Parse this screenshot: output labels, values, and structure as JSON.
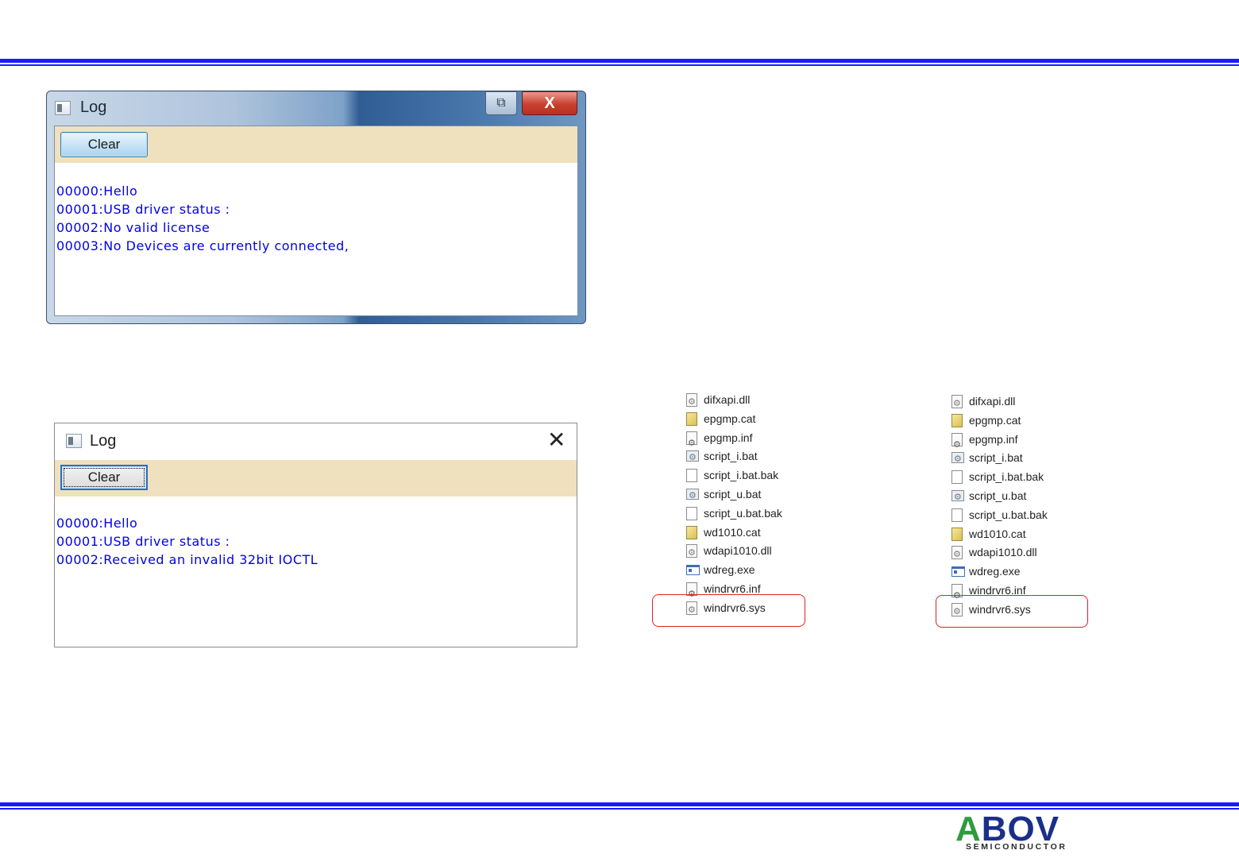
{
  "colors": {
    "rule_blue": "#1a1aff",
    "log_text": "#0000ee",
    "toolbar_bg": "#efe1bd",
    "highlight_red": "#e0202a"
  },
  "window_old": {
    "title": "Log",
    "restore_icon": "restore-icon",
    "close_glyph": "X",
    "clear_label": "Clear",
    "lines": [
      "00000:Hello",
      "00001:USB driver status :",
      "00002:No valid license",
      "00003:No Devices are currently connected,"
    ]
  },
  "window_new": {
    "title": "Log",
    "close_glyph": "✕",
    "clear_label": "Clear",
    "lines": [
      "00000:Hello",
      "00001:USB driver status :",
      "00002:Received an invalid 32bit IOCTL"
    ]
  },
  "files_left": [
    {
      "name": "difxapi.dll",
      "icon": "dll-icon"
    },
    {
      "name": "epgmp.cat",
      "icon": "cat-icon"
    },
    {
      "name": "epgmp.inf",
      "icon": "inf-icon"
    },
    {
      "name": "script_i.bat",
      "icon": "bat-icon"
    },
    {
      "name": "script_i.bat.bak",
      "icon": "blank-file-icon"
    },
    {
      "name": "script_u.bat",
      "icon": "bat-icon"
    },
    {
      "name": "script_u.bat.bak",
      "icon": "blank-file-icon"
    },
    {
      "name": "wd1010.cat",
      "icon": "cat-icon"
    },
    {
      "name": "wdapi1010.dll",
      "icon": "dll-icon"
    },
    {
      "name": "wdreg.exe",
      "icon": "exe-icon"
    },
    {
      "name": "windrvr6.inf",
      "icon": "inf-icon"
    },
    {
      "name": "windrvr6.sys",
      "icon": "sys-icon"
    }
  ],
  "files_right": [
    {
      "name": "difxapi.dll",
      "icon": "dll-icon"
    },
    {
      "name": "epgmp.cat",
      "icon": "cat-icon"
    },
    {
      "name": "epgmp.inf",
      "icon": "inf-icon"
    },
    {
      "name": "script_i.bat",
      "icon": "bat-icon"
    },
    {
      "name": "script_i.bat.bak",
      "icon": "blank-file-icon"
    },
    {
      "name": "script_u.bat",
      "icon": "bat-icon"
    },
    {
      "name": "script_u.bat.bak",
      "icon": "blank-file-icon"
    },
    {
      "name": "wd1010.cat",
      "icon": "cat-icon"
    },
    {
      "name": "wdapi1010.dll",
      "icon": "dll-icon"
    },
    {
      "name": "wdreg.exe",
      "icon": "exe-icon"
    },
    {
      "name": "windrvr6.inf",
      "icon": "inf-icon"
    },
    {
      "name": "windrvr6.sys",
      "icon": "sys-icon"
    }
  ],
  "logo": {
    "brand": "ABOV",
    "tagline": "SEMICONDUCTOR"
  }
}
